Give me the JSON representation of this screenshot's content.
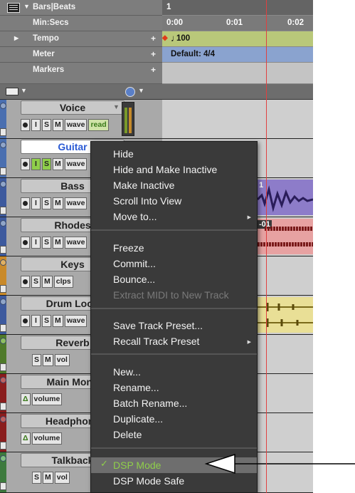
{
  "ruler": {
    "rows": [
      {
        "name": "Bars|Beats",
        "value": "1"
      },
      {
        "name": "Min:Secs",
        "ticks": [
          "0:00",
          "0:01",
          "0:02"
        ]
      },
      {
        "name": "Tempo",
        "value": "100"
      },
      {
        "name": "Meter",
        "value": "Default: 4/4"
      },
      {
        "name": "Markers"
      }
    ]
  },
  "tracks": [
    {
      "name": "Voice",
      "buttons": [
        "I",
        "S",
        "M",
        "wave",
        "read"
      ],
      "color": "#4a6fb0"
    },
    {
      "name": "Guitar",
      "buttons": [
        "I",
        "S",
        "M",
        "wave"
      ],
      "color": "#4a6fb0",
      "selected": true
    },
    {
      "name": "Bass",
      "buttons": [
        "I",
        "S",
        "M",
        "wave"
      ],
      "color": "#3d5a9e"
    },
    {
      "name": "Rhodes",
      "buttons": [
        "I",
        "S",
        "M",
        "wave"
      ],
      "color": "#3d5a9e"
    },
    {
      "name": "Keys",
      "buttons": [
        "S",
        "M",
        "clps"
      ],
      "color": "#c98a2a"
    },
    {
      "name": "Drum Loop",
      "buttons": [
        "I",
        "S",
        "M",
        "wave"
      ],
      "color": "#3d5a9e"
    },
    {
      "name": "Reverb",
      "buttons": [
        "S",
        "M",
        "vol"
      ],
      "color": "#4f7a2a"
    },
    {
      "name": "Main Monit",
      "buttons": [
        "volume"
      ],
      "color": "#8a1d1d"
    },
    {
      "name": "Headphone",
      "buttons": [
        "volume"
      ],
      "color": "#8a1d1d"
    },
    {
      "name": "Talkback",
      "buttons": [
        "S",
        "M",
        "vol"
      ],
      "color": "#3d7a3d"
    }
  ],
  "clips": {
    "bass_label": "1",
    "rhodes_label": "-01"
  },
  "menu": {
    "items": [
      {
        "label": "Hide"
      },
      {
        "label": "Hide and Make Inactive"
      },
      {
        "label": "Make Inactive"
      },
      {
        "label": "Scroll Into View"
      },
      {
        "label": "Move to...",
        "submenu": true
      },
      {
        "label": "Freeze"
      },
      {
        "label": "Commit..."
      },
      {
        "label": "Bounce..."
      },
      {
        "label": "Extract MIDI to New Track",
        "disabled": true
      },
      {
        "label": "Save Track Preset..."
      },
      {
        "label": "Recall Track Preset",
        "submenu": true
      },
      {
        "label": "New..."
      },
      {
        "label": "Rename..."
      },
      {
        "label": "Batch Rename..."
      },
      {
        "label": "Duplicate..."
      },
      {
        "label": "Delete"
      },
      {
        "label": "DSP Mode",
        "checked": true,
        "highlighted": true
      },
      {
        "label": "DSP Mode Safe"
      }
    ]
  }
}
